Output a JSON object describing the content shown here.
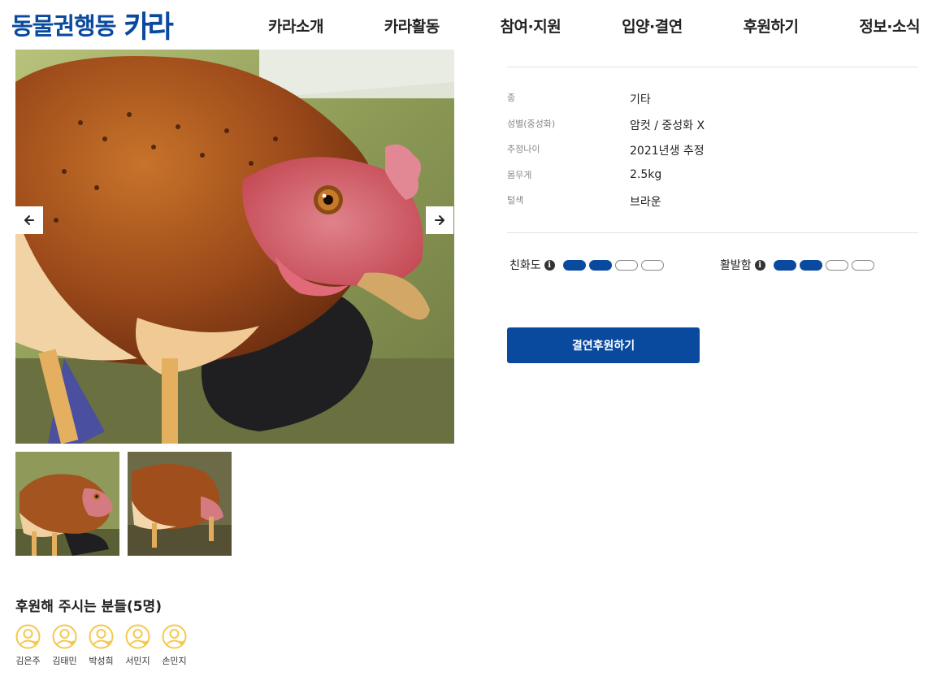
{
  "header": {
    "logo_text": "동물권행동",
    "logo_mark": "카라",
    "nav": [
      "카라소개",
      "카라활동",
      "참여·지원",
      "입양·결연",
      "후원하기",
      "정보·소식"
    ]
  },
  "gallery": {
    "prev_icon": "arrow-left-icon",
    "next_icon": "arrow-right-icon",
    "thumbnail_count": 2
  },
  "details": [
    {
      "label": "종",
      "value": "기타"
    },
    {
      "label": "성별(중성화)",
      "value": "암컷 / 중성화 X"
    },
    {
      "label": "추정나이",
      "value": "2021년생 추정"
    },
    {
      "label": "몸무게",
      "value": "2.5kg"
    },
    {
      "label": "털색",
      "value": "브라운"
    }
  ],
  "ratings": [
    {
      "label": "친화도",
      "filled": 2,
      "total": 4
    },
    {
      "label": "활발함",
      "filled": 2,
      "total": 4
    }
  ],
  "cta_label": "결연후원하기",
  "supporters": {
    "title": "후원해 주시는 분들(5명)",
    "names": [
      "김은주",
      "김태민",
      "박성희",
      "서민지",
      "손민지"
    ]
  },
  "colors": {
    "brand": "#0a4a9e",
    "supporter_icon": "#f5c84c"
  }
}
